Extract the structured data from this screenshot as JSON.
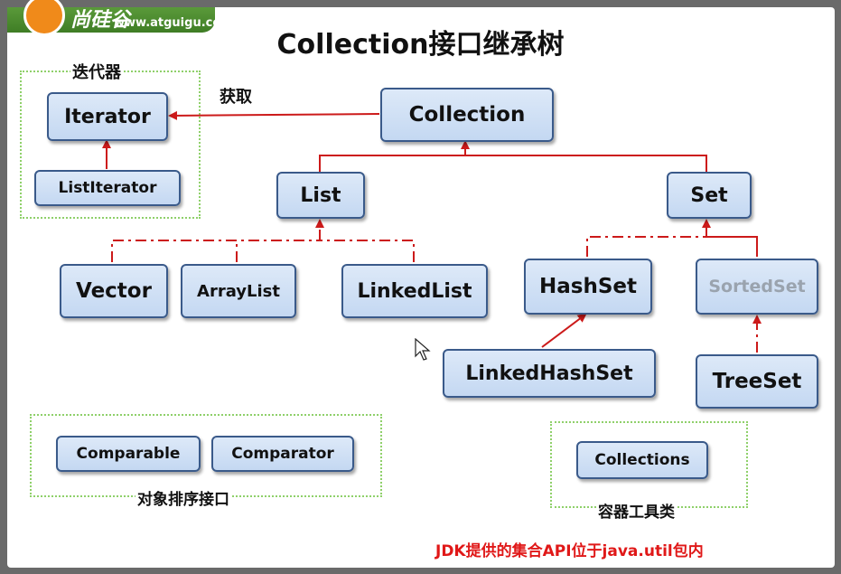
{
  "header": {
    "logo_text": "尚硅谷",
    "logo_url": "www.atguigu.com"
  },
  "title": "Collection接口继承树",
  "nodes": {
    "collection": "Collection",
    "iterator": "Iterator",
    "list_iterator": "ListIterator",
    "list": "List",
    "set": "Set",
    "vector": "Vector",
    "array_list": "ArrayList",
    "linked_list": "LinkedList",
    "hash_set": "HashSet",
    "sorted_set": "SortedSet",
    "linked_hash_set": "LinkedHashSet",
    "tree_set": "TreeSet",
    "comparable": "Comparable",
    "comparator": "Comparator",
    "collections": "Collections"
  },
  "labels": {
    "iterator_group": "迭代器",
    "obtain_edge": "获取",
    "compare_group": "对象排序接口",
    "tools_group": "容器工具类"
  },
  "footer_note": "JDK提供的集合API位于java.util包内",
  "colors": {
    "accent_red": "#cc1a1a",
    "note_red": "#e01818",
    "box_border": "#3a5a8a",
    "group_border": "#8fd06a"
  }
}
